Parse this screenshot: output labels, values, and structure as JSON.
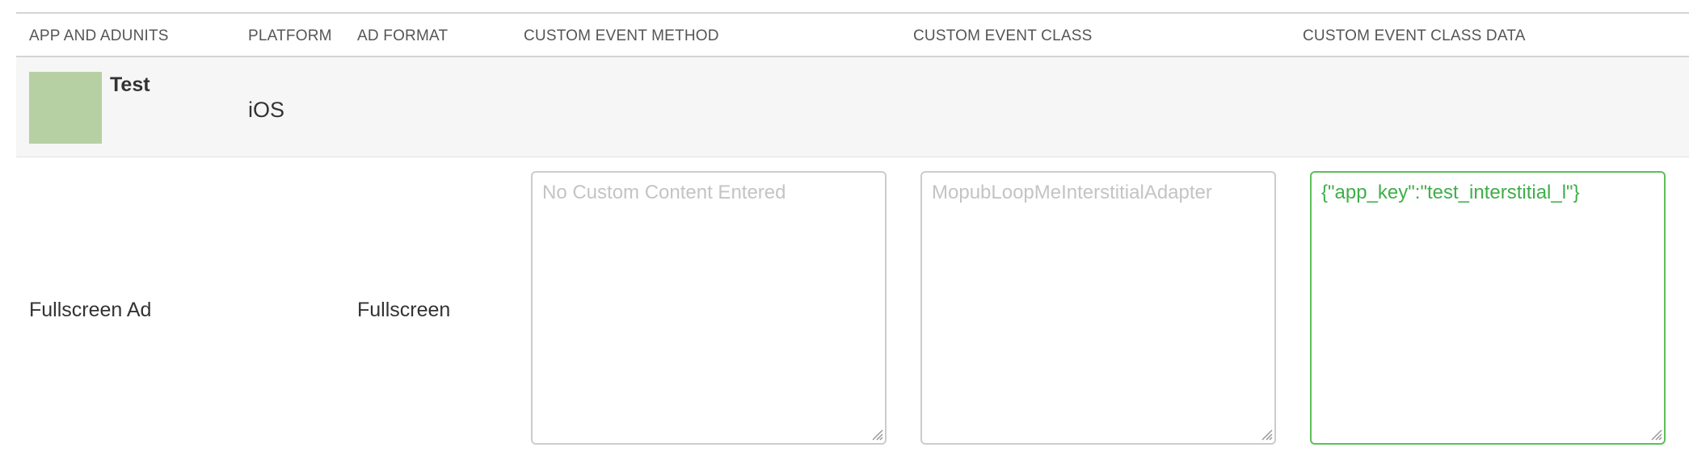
{
  "headers": {
    "app_and_adunits": "APP AND ADUNITS",
    "platform": "PLATFORM",
    "ad_format": "AD FORMAT",
    "custom_event_method": "CUSTOM EVENT METHOD",
    "custom_event_class": "CUSTOM EVENT CLASS",
    "custom_event_class_data": "CUSTOM EVENT CLASS DATA"
  },
  "app": {
    "name": "Test",
    "platform": "iOS",
    "icon_color": "#b7d0a3"
  },
  "adunit": {
    "name": "Fullscreen Ad",
    "format": "Fullscreen",
    "custom_event_method_placeholder": "No Custom Content Entered",
    "custom_event_method_value": "",
    "custom_event_class_value": "MopubLoopMeInterstitialAdapter",
    "custom_event_class_data_value": "{\"app_key\":\"test_interstitial_l\"}"
  },
  "colors": {
    "valid_border": "#5cbf5c",
    "valid_text": "#3fae49",
    "muted_text": "#c4c4c4"
  }
}
